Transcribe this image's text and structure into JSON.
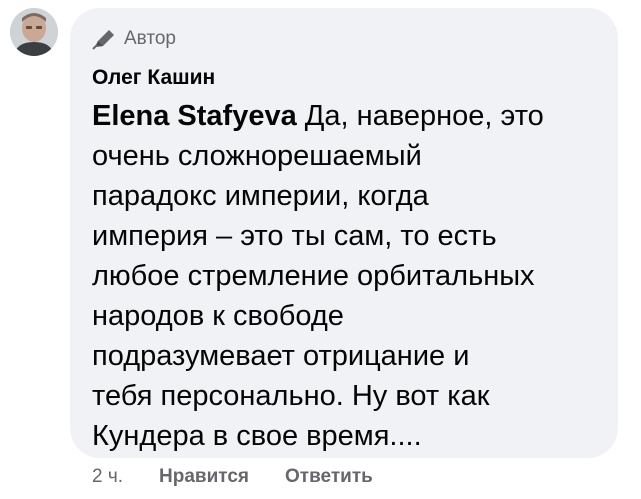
{
  "comment": {
    "badge_label": "Автор",
    "author": "Олег Кашин",
    "mention": "Elena Stafyeva",
    "text_lines": [
      " Да, наверное, это",
      "очень сложнорешаемый",
      "парадокс империи, когда",
      "империя – это ты сам, то есть",
      "любое стремление орбитальных",
      "народов к свободе",
      "подразумевает отрицание и",
      "тебя персонально. Ну вот как",
      "Кундера в свое время...."
    ]
  },
  "actions": {
    "timestamp": "2 ч.",
    "like_label": "Нравится",
    "reply_label": "Ответить"
  },
  "icons": {
    "badge": "pen-icon",
    "avatar": "avatar"
  },
  "colors": {
    "bubble": "#f0f2f5",
    "text": "#050505",
    "secondary": "#65676b"
  }
}
